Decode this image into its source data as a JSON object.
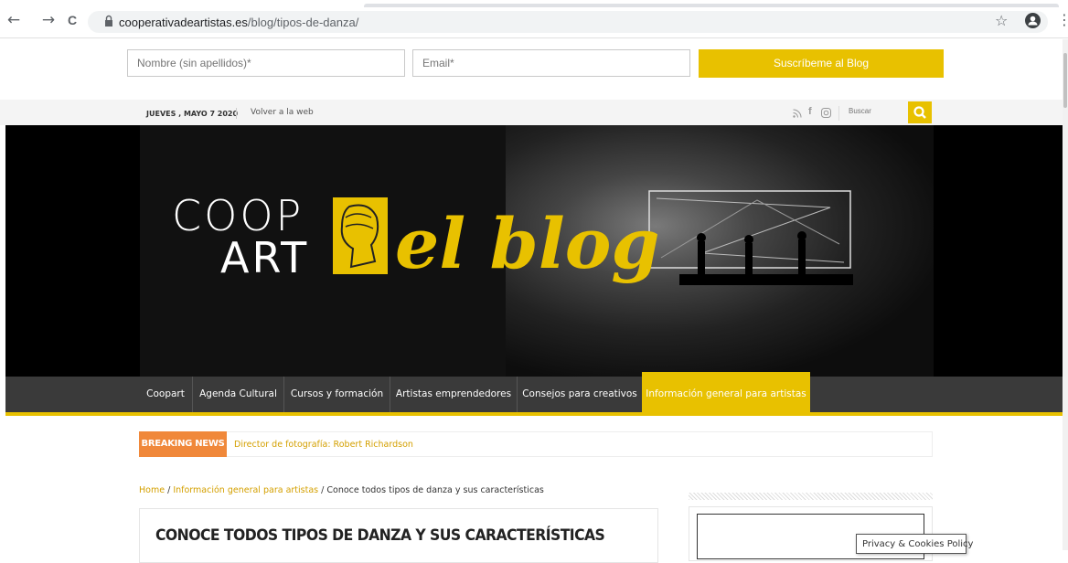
{
  "browser": {
    "url_domain": "cooperativadeartistas.es",
    "url_path": "/blog/tipos-de-danza/",
    "back_icon": "←",
    "forward_icon": "→",
    "reload_icon": "C",
    "star_icon": "☆",
    "menu_icon": "⋮"
  },
  "subscribe": {
    "name_placeholder": "Nombre (sin apellidos)*",
    "email_placeholder": "Email*",
    "button_label": "Suscríbeme al Blog"
  },
  "topbar": {
    "date": "JUEVES , MAYO 7 2020",
    "back_link": "Volver a la web",
    "search_placeholder": "Buscar",
    "social": [
      "rss-icon",
      "facebook-icon",
      "instagram-icon"
    ]
  },
  "hero": {
    "logo_line1": "COOP",
    "logo_line2": "ART",
    "tagline": "el blog"
  },
  "nav": {
    "items": [
      {
        "label": "Coopart"
      },
      {
        "label": "Agenda Cultural"
      },
      {
        "label": "Cursos y formación"
      },
      {
        "label": "Artistas emprendedores"
      },
      {
        "label": "Consejos para creativos"
      },
      {
        "label": "Información general para artistas"
      }
    ],
    "active_index": 5
  },
  "breaking": {
    "label": "BREAKING NEWS",
    "headline": "Director de fotografía: Robert Richardson"
  },
  "breadcrumb": {
    "home": "Home",
    "sep": "/",
    "category": "Información general para artistas",
    "current": "Conoce todos tipos de danza y sus características"
  },
  "article": {
    "title": "CONOCE TODOS TIPOS DE DANZA Y SUS CARACTERÍSTICAS"
  },
  "cookie": {
    "label": "Privacy & Cookies Policy"
  },
  "colors": {
    "accent": "#e8c100",
    "breaking": "#f0883a",
    "nav_bg": "#3a3a3a"
  }
}
